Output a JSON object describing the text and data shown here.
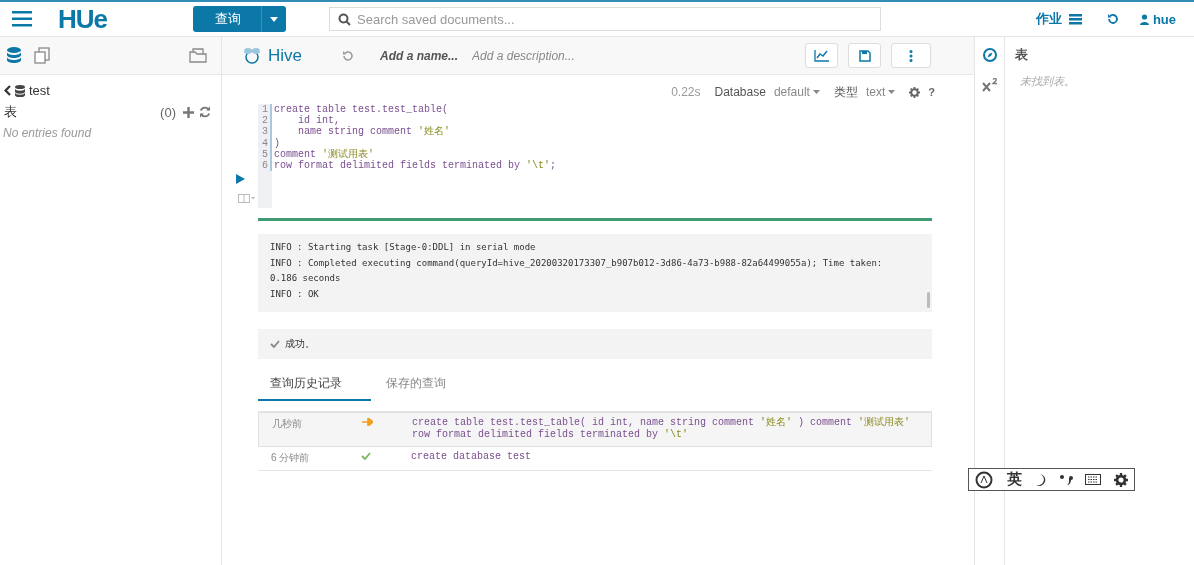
{
  "topbar": {
    "logo": "HUe",
    "query_button": "查询",
    "search": {
      "placeholder": "Search saved documents..."
    },
    "jobs": "作业",
    "user": "hue"
  },
  "left_panel": {
    "database": "test",
    "section": "表",
    "count": "(0)",
    "empty": "No entries found"
  },
  "editor_header": {
    "title": "Hive",
    "name_placeholder": "Add a name...",
    "description_placeholder": "Add a description..."
  },
  "editor_toolbar": {
    "time": "0.22s",
    "database_label": "Database",
    "database_value": "default",
    "type_label": "类型",
    "type_value": "text",
    "help": "?"
  },
  "code_lines": [
    {
      "number": "1",
      "text": "create table test.test_table("
    },
    {
      "number": "2",
      "text": "    id int,"
    },
    {
      "number": "3",
      "text": "    name string comment '姓名'"
    },
    {
      "number": "4",
      "text": ")"
    },
    {
      "number": "5",
      "text": "comment '测试用表'"
    },
    {
      "number": "6",
      "text": "row format delimited fields terminated by '\\t';"
    }
  ],
  "log_lines": [
    "INFO  : Starting task [Stage-0:DDL] in serial mode",
    "INFO  : Completed executing command(queryId=hive_20200320173307_b907b012-3d86-4a73-b988-82a64499055a); Time taken: 0.186 seconds",
    "INFO  : OK"
  ],
  "result": "成功。",
  "result_tabs": [
    {
      "label": "查询历史记录",
      "selected": true
    },
    {
      "label": "保存的查询",
      "selected": false
    }
  ],
  "history": [
    {
      "time": "几秒前",
      "kind": "running",
      "selected": true,
      "query": [
        "create table test.test_table( id int, name string comment '姓名' ) comment '测试用表'",
        "row format delimited fields terminated by '\\t'"
      ]
    },
    {
      "time": "6 分钟前",
      "kind": "success",
      "selected": false,
      "query": [
        "create database test"
      ]
    }
  ],
  "assist_panel": {
    "title": "表",
    "empty": "未找到表。"
  },
  "ime_toolbar": {
    "language": "英"
  }
}
